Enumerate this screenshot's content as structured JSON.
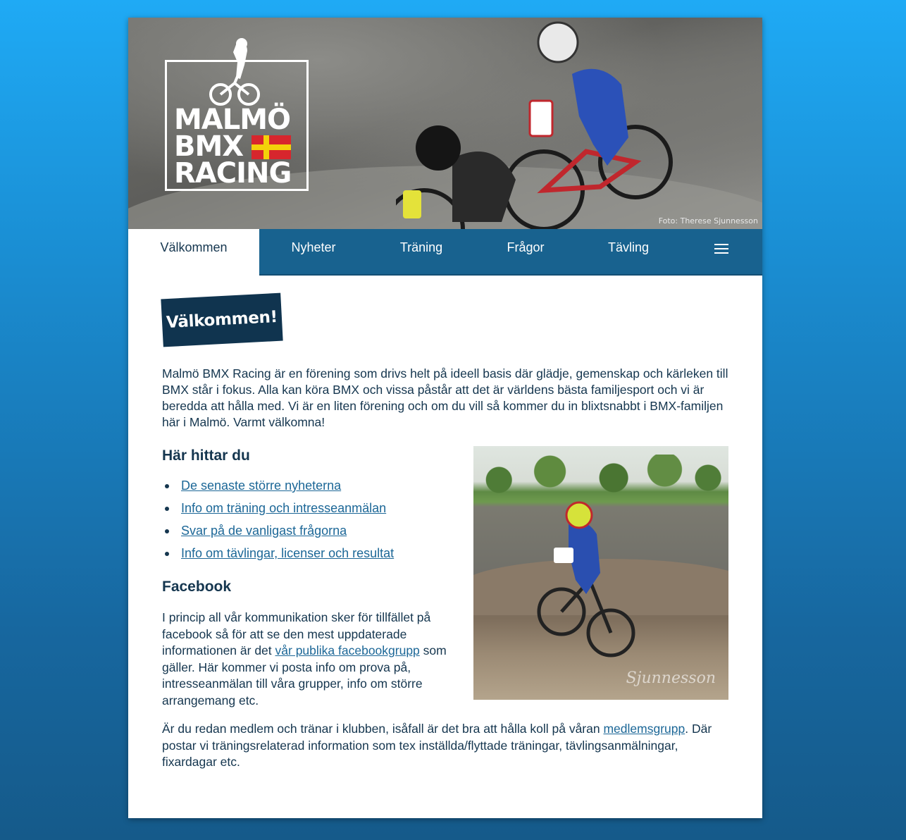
{
  "hero": {
    "logo_line1": "MALMÖ",
    "logo_line2": "BMX",
    "logo_line3": "RACING",
    "photo_credit": "Foto: Therese Sjunnesson"
  },
  "nav": {
    "items": [
      {
        "label": "Välkommen",
        "active": true
      },
      {
        "label": "Nyheter"
      },
      {
        "label": "Träning"
      },
      {
        "label": "Frågor"
      },
      {
        "label": "Tävling"
      }
    ],
    "menu_icon": "hamburger-menu-icon"
  },
  "content": {
    "badge": "Välkommen!",
    "intro": "Malmö BMX Racing är en förening som drivs helt på ideell basis där glädje, gemenskap och kärleken till BMX står i fokus. Alla kan köra BMX och vissa påstår att det är världens bästa familjesport och vi är beredda att hålla med. Vi är en liten förening och om du vill så kommer du in blixtsnabbt i BMX-familjen här i Malmö. Varmt välkomna!",
    "find_heading": "Här hittar du",
    "links": [
      "De senaste större nyheterna",
      "Info om träning och intresseanmälan",
      "Svar på de vanligast frågorna",
      "Info om tävlingar, licenser och resultat"
    ],
    "facebook_heading": "Facebook",
    "facebook_text_before": "I princip all vår kommunikation sker för tillfället på facebook så för att se den mest uppdaterade informationen är det ",
    "facebook_link": "vår publika facebookgrupp",
    "facebook_text_after": " som gäller. Här kommer vi posta info om prova på, intresseanmälan till våra grupper, info om större arrangemang etc.",
    "member_text_before": "Är du redan medlem och tränar i klubben, isåfall är det bra att hålla koll på våran ",
    "member_link": "medlemsgrupp",
    "member_text_after": ". Där postar vi träningsrelaterad information som tex inställda/flyttade träningar, tävlingsanmälningar, fixardagar etc.",
    "side_photo_watermark": "Sjunnesson"
  },
  "colors": {
    "nav_bg": "#18628f",
    "badge_bg": "#10344f",
    "link": "#1c6797",
    "text": "#15364f"
  }
}
